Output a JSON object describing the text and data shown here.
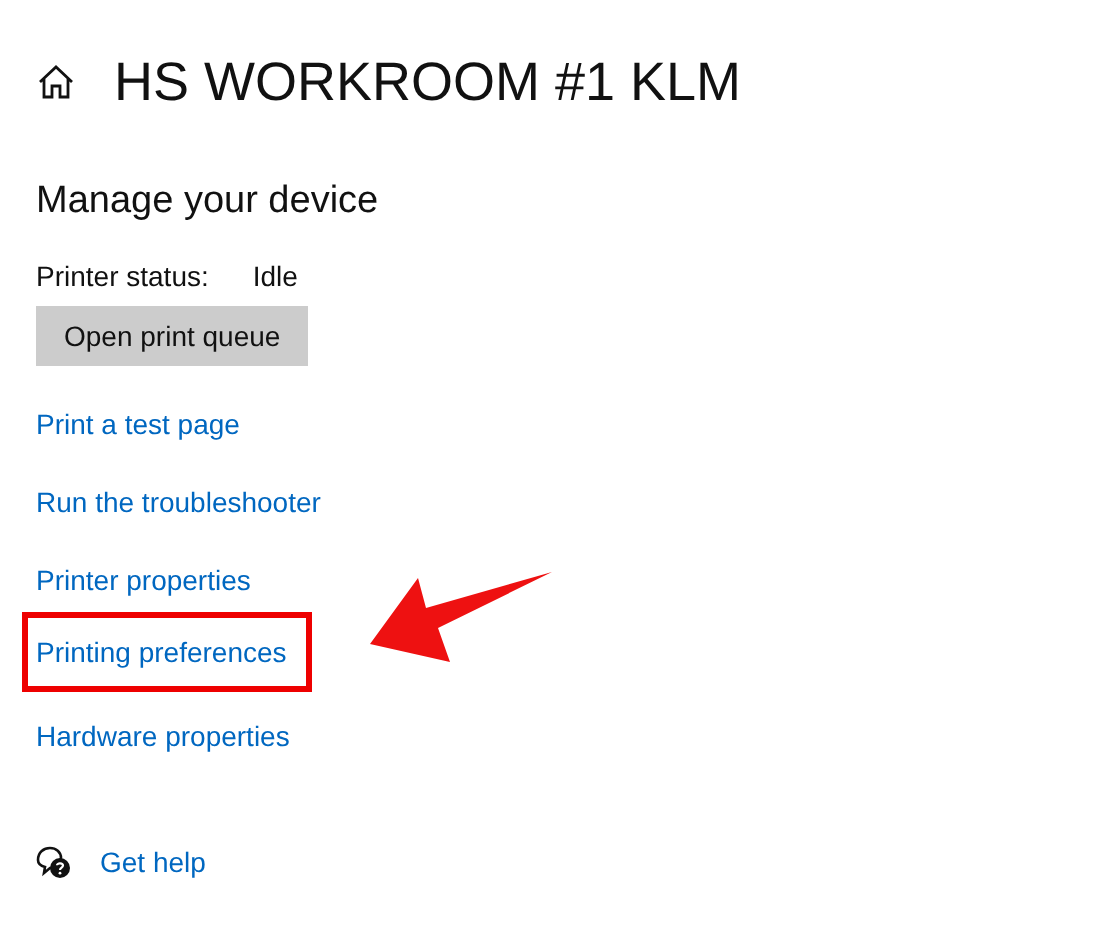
{
  "header": {
    "title": "HS WORKROOM #1 KLM"
  },
  "section": {
    "heading": "Manage your device"
  },
  "status": {
    "label": "Printer status:",
    "value": "Idle"
  },
  "button": {
    "label": "Open print queue"
  },
  "links": [
    {
      "label": "Print a test page",
      "highlighted": false
    },
    {
      "label": "Run the troubleshooter",
      "highlighted": false
    },
    {
      "label": "Printer properties",
      "highlighted": false
    },
    {
      "label": "Printing preferences",
      "highlighted": true
    },
    {
      "label": "Hardware properties",
      "highlighted": false
    }
  ],
  "help": {
    "label": "Get help"
  }
}
